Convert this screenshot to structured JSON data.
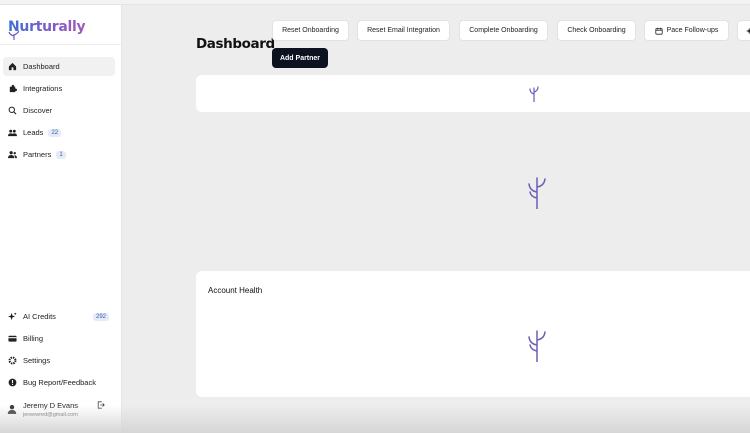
{
  "app": {
    "name": "Nurturally"
  },
  "sidebar": {
    "items": [
      {
        "label": "Dashboard",
        "icon": "home-icon",
        "active": true
      },
      {
        "label": "Integrations",
        "icon": "puzzle-icon"
      },
      {
        "label": "Discover",
        "icon": "search-icon"
      },
      {
        "label": "Leads",
        "icon": "users-icon",
        "badge": "22"
      },
      {
        "label": "Partners",
        "icon": "partners-icon",
        "badge": "1"
      }
    ],
    "bottom_items": [
      {
        "label": "AI Credits",
        "icon": "sparkle-icon",
        "badge": "292"
      },
      {
        "label": "Billing",
        "icon": "card-icon"
      },
      {
        "label": "Settings",
        "icon": "gear-icon"
      },
      {
        "label": "Bug Report/Feedback",
        "icon": "alert-icon"
      }
    ],
    "user": {
      "name": "Jeremy D Evans",
      "email": "jereewred@gmail.com"
    }
  },
  "header": {
    "title": "Dashboard",
    "actions": [
      {
        "label": "Reset Onboarding"
      },
      {
        "label": "Reset Email Integration"
      },
      {
        "label": "Complete Onboarding"
      },
      {
        "label": "Check Onboarding"
      },
      {
        "label": "Pace Follow-ups",
        "icon": "calendar-icon"
      }
    ],
    "primary_action": "Add Partner"
  },
  "cards": {
    "account_health": {
      "title": "Account Health"
    }
  },
  "colors": {
    "brand_blue": "#3b6fd9",
    "brand_purple": "#7a5cc8",
    "primary_button": "#0d1220",
    "loader": "#6b5fb5"
  }
}
